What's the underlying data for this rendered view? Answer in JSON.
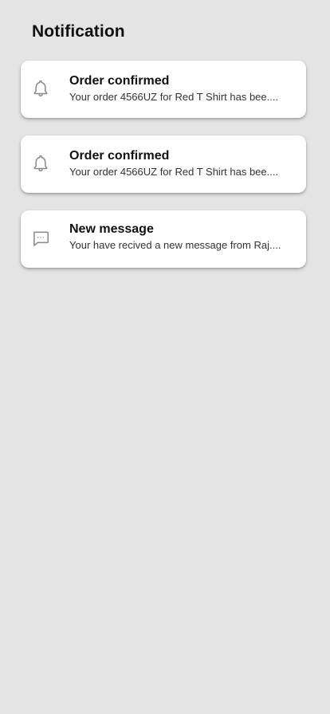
{
  "header": {
    "title": "Notification"
  },
  "notifications": [
    {
      "icon": "bell-icon",
      "title": "Order confirmed",
      "body": "Your order 4566UZ for Red T Shirt has bee...."
    },
    {
      "icon": "bell-icon",
      "title": "Order confirmed",
      "body": "Your order 4566UZ for Red T Shirt has bee...."
    },
    {
      "icon": "message-icon",
      "title": "New message",
      "body": "Your have recived a new message from Raj...."
    }
  ],
  "colors": {
    "background": "#e4e4e4",
    "card": "#ffffff",
    "icon": "#8a8a8a"
  }
}
